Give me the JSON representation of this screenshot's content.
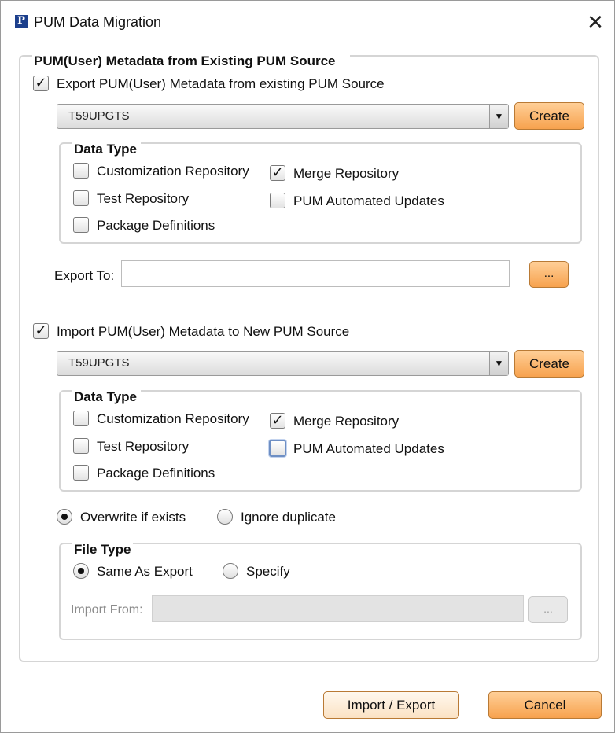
{
  "window": {
    "title": "PUM Data Migration",
    "icon_letter": "P",
    "close_glyph": "✕"
  },
  "source_section": {
    "legend": "PUM(User) Metadata from Existing PUM Source",
    "export_checkbox_label": "Export PUM(User) Metadata from existing PUM Source",
    "export_checked": true,
    "database": "T59UPGTS",
    "create_label": "Create",
    "data_type": {
      "legend": "Data Type",
      "customization_repository": "Customization Repository",
      "test_repository": "Test Repository",
      "package_definitions": "Package Definitions",
      "merge_repository": "Merge Repository",
      "pum_automated_updates": "PUM Automated Updates"
    },
    "export_to_label": "Export To:",
    "export_to_value": "",
    "browse_label": "..."
  },
  "target_section": {
    "import_checkbox_label": "Import PUM(User) Metadata to New PUM Source",
    "import_checked": true,
    "database": "T59UPGTS",
    "create_label": "Create",
    "data_type": {
      "legend": "Data Type",
      "customization_repository": "Customization Repository",
      "test_repository": "Test Repository",
      "package_definitions": "Package Definitions",
      "merge_repository": "Merge Repository",
      "pum_automated_updates": "PUM Automated Updates"
    },
    "overwrite_label": "Overwrite if exists",
    "ignore_label": "Ignore duplicate",
    "file_type": {
      "legend": "File Type",
      "same_as_export_label": "Same As Export",
      "specify_label": "Specify",
      "import_from_label": "Import From:",
      "import_from_value": "",
      "browse_label": "..."
    }
  },
  "footer": {
    "import_export_label": "Import / Export",
    "cancel_label": "Cancel"
  }
}
